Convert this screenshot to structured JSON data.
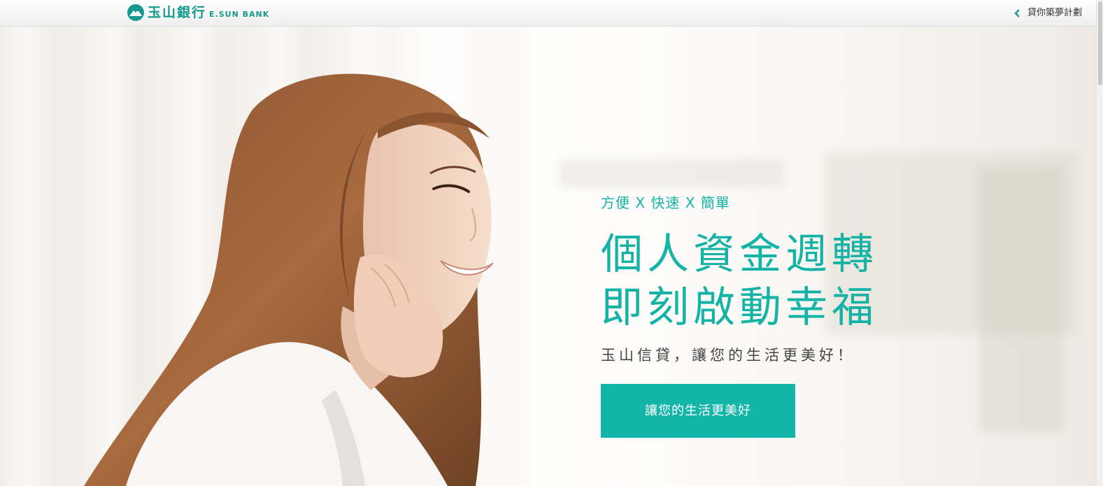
{
  "header": {
    "logo_zh": "玉山銀行",
    "logo_en": "E.SUN BANK",
    "back_link_label": "貸你築夢計劃"
  },
  "hero": {
    "tagline": "方便 X 快速 X 簡單",
    "headline_line1": "個人資金週轉",
    "headline_line2": "即刻啟動幸福",
    "subline": "玉山信貸，讓您的生活更美好！",
    "cta_label": "讓您的生活更美好"
  },
  "colors": {
    "brand_teal": "#14998f",
    "accent_teal": "#13b5a9"
  },
  "icons": {
    "logo": "esun-mountain-logo-icon",
    "back": "chevron-left-icon"
  }
}
